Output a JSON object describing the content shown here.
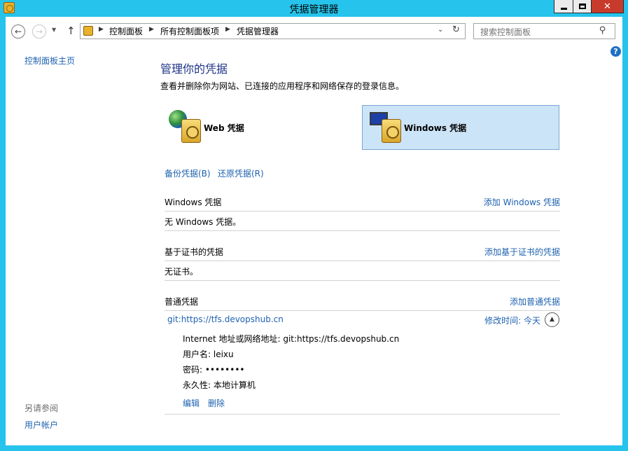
{
  "window": {
    "title": "凭据管理器"
  },
  "address_bar": {
    "breadcrumbs": [
      "控制面板",
      "所有控制面板项",
      "凭据管理器"
    ]
  },
  "search": {
    "placeholder": "搜索控制面板"
  },
  "left_nav": {
    "home_link": "控制面板主页",
    "see_also_heading": "另请参阅",
    "see_also_links": [
      "用户帐户"
    ]
  },
  "main": {
    "heading": "管理你的凭据",
    "description": "查看并删除你为网站、已连接的应用程序和网络保存的登录信息。",
    "vault_tabs": [
      {
        "label": "Web 凭据",
        "icon": "globe-safe-icon",
        "selected": false
      },
      {
        "label": "Windows 凭据",
        "icon": "monitor-safe-icon",
        "selected": true
      }
    ],
    "actions": {
      "backup": "备份凭据(B)",
      "restore": "还原凭据(R)"
    },
    "sections": {
      "windows": {
        "title": "Windows 凭据",
        "add_link": "添加 Windows 凭据",
        "empty_text": "无 Windows 凭据。"
      },
      "certificate": {
        "title": "基于证书的凭据",
        "add_link": "添加基于证书的凭据",
        "empty_text": "无证书。"
      },
      "generic": {
        "title": "普通凭据",
        "add_link": "添加普通凭据",
        "credential": {
          "name": "git:https://tfs.devopshub.cn",
          "modified": "修改时间:  今天",
          "address": "Internet 地址或网络地址:  git:https://tfs.devopshub.cn",
          "username": "用户名:  leixu",
          "password": "密码:  ••••••••",
          "persistence": "永久性:  本地计算机",
          "edit_link": "编辑",
          "delete_link": "删除"
        }
      }
    }
  },
  "colors": {
    "frame": "#26c4ec",
    "link": "#1e62b0",
    "heading": "#1e3287",
    "selected_tab": "#cce4f7",
    "close_button": "#c83a2c"
  }
}
